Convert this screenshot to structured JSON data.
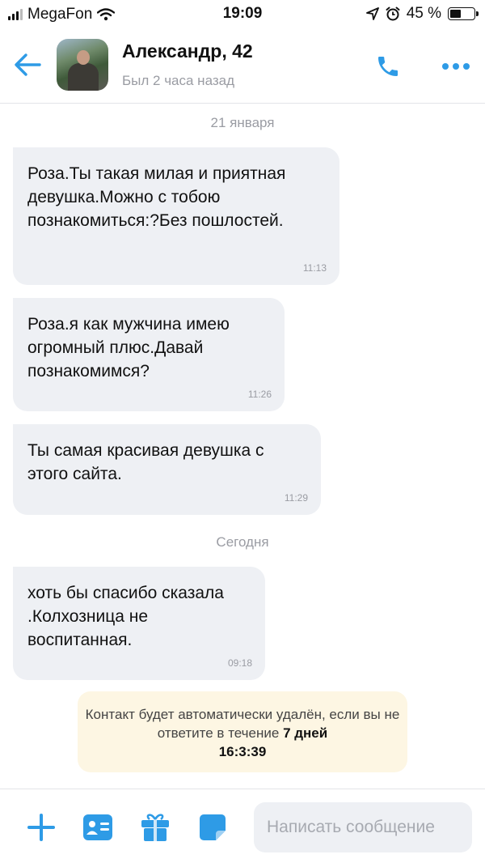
{
  "status_bar": {
    "carrier": "MegaFon",
    "time": "19:09",
    "battery": "45 %",
    "battery_level": 0.45
  },
  "header": {
    "contact_name": "Александр, 42",
    "contact_status": "Был 2 часа назад"
  },
  "chat": {
    "date_1": "21 января",
    "date_2": "Сегодня",
    "messages": [
      {
        "text": "Роза.Ты такая милая и приятная девушка.Можно с тобою познакомиться:?Без пошлостей.",
        "time": "11:13"
      },
      {
        "text": "Роза.я как мужчина имею огромный плюс.Давай познакомимся?",
        "time": "11:26"
      },
      {
        "text": "Ты самая красивая девушка с этого сайта.",
        "time": "11:29"
      },
      {
        "text": "хоть бы спасибо сказала .Колхозница не воспитанная.",
        "time": "09:18"
      }
    ]
  },
  "notice": {
    "text_before": "Контакт будет автоматически удалён, если вы не ответите в течение",
    "days": "7 дней",
    "countdown": "16:3:39"
  },
  "composer": {
    "placeholder": "Написать сообщение"
  },
  "colors": {
    "accent": "#2e9be6",
    "bubble": "#eef0f4",
    "notice_bg": "#fdf6e3"
  },
  "icons": [
    "signal-icon",
    "wifi-icon",
    "location-icon",
    "alarm-icon",
    "battery-icon",
    "back-arrow-icon",
    "phone-icon",
    "more-icon",
    "plus-icon",
    "contact-card-icon",
    "gift-icon",
    "sticker-icon"
  ]
}
